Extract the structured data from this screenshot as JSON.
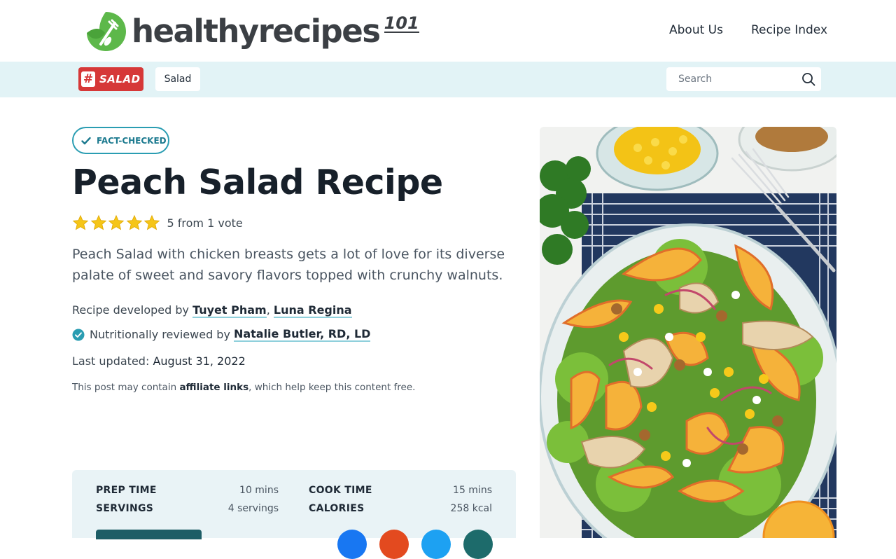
{
  "header": {
    "logo_text": "healthyrecipes",
    "logo_sup": "101",
    "nav": [
      {
        "label": "About Us"
      },
      {
        "label": "Recipe Index"
      }
    ]
  },
  "subbar": {
    "tag_hash": "#",
    "tag_label": "SALAD",
    "category": "Salad",
    "search_placeholder": "Search"
  },
  "article": {
    "badge": "FACT-CHECKED",
    "title": "Peach Salad Recipe",
    "rating": {
      "stars": 5,
      "max": 5,
      "text": "5 from 1 vote"
    },
    "description": "Peach Salad with chicken breasts gets a lot of love for its diverse palate of sweet and savory flavors topped with crunchy walnuts.",
    "developed_prefix": "Recipe developed by",
    "developers": [
      "Tuyet Pham",
      "Luna Regina"
    ],
    "developer_sep": ",",
    "reviewed_prefix": "Nutritionally reviewed by",
    "reviewer": "Natalie Butler, RD, LD",
    "updated_prefix": "Last updated:",
    "updated_date": "August 31, 2022",
    "affiliate_prefix": "This post may contain",
    "affiliate_link": "affiliate links",
    "affiliate_suffix": ", which help keep this content free."
  },
  "recipe_card": {
    "prep_label": "PREP TIME",
    "prep_value": "10 mins",
    "cook_label": "COOK TIME",
    "cook_value": "15 mins",
    "servings_label": "SERVINGS",
    "servings_value": "4 servings",
    "calories_label": "CALORIES",
    "calories_value": "258 kcal",
    "social_colors": [
      "#1877f2",
      "#e34a1f",
      "#1da1f2",
      "#1d6b6b"
    ]
  },
  "colors": {
    "accent": "#2a9db2",
    "tag_red": "#d63838",
    "subbar_bg": "#e2f3f6",
    "logo_green": "#5db84a",
    "star": "#f5c518"
  }
}
